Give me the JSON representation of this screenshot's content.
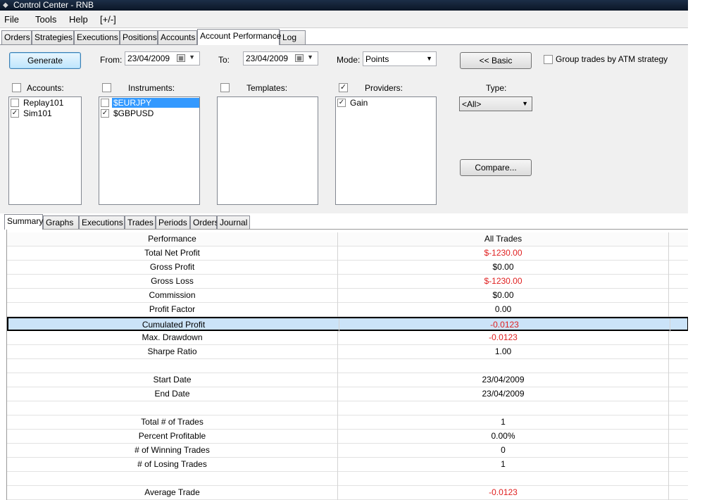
{
  "window": {
    "title": "Control Center - RNB",
    "icon": "app-icon"
  },
  "menu": [
    "File",
    "Tools",
    "Help",
    "[+/-]"
  ],
  "tabs": [
    "Orders",
    "Strategies",
    "Executions",
    "Positions",
    "Accounts",
    "Account Performance",
    "Log"
  ],
  "active_tab": "Account Performance",
  "controls": {
    "generate_label": "Generate",
    "from_label": "From:",
    "from_value": "23/04/2009",
    "to_label": "To:",
    "to_value": "23/04/2009",
    "mode_label": "Mode:",
    "mode_value": "Points",
    "basic_label": "<< Basic",
    "group_atm_label": "Group trades by ATM strategy",
    "type_label": "Type:",
    "type_value": "<All>",
    "compare_label": "Compare..."
  },
  "lists": {
    "accounts": {
      "label": "Accounts:",
      "header_checked": false,
      "items": [
        {
          "name": "Replay101",
          "checked": false
        },
        {
          "name": "Sim101",
          "checked": true
        }
      ]
    },
    "instruments": {
      "label": "Instruments:",
      "header_checked": false,
      "items": [
        {
          "name": "$EURJPY",
          "checked": false,
          "selected": true
        },
        {
          "name": "$GBPUSD",
          "checked": true
        }
      ]
    },
    "templates": {
      "label": "Templates:",
      "header_checked": false,
      "items": []
    },
    "providers": {
      "label": "Providers:",
      "header_checked": true,
      "items": [
        {
          "name": "Gain",
          "checked": true
        }
      ]
    }
  },
  "subtabs": [
    "Summary",
    "Graphs",
    "Executions",
    "Trades",
    "Periods",
    "Orders",
    "Journal"
  ],
  "active_subtab": "Summary",
  "grid": {
    "headers": [
      "Performance",
      "All Trades"
    ],
    "rows": [
      {
        "label": "Total Net Profit",
        "value": "$-1230.00",
        "negative": true
      },
      {
        "label": "Gross Profit",
        "value": "$0.00",
        "negative": false
      },
      {
        "label": "Gross Loss",
        "value": "$-1230.00",
        "negative": true
      },
      {
        "label": "Commission",
        "value": "$0.00",
        "negative": false
      },
      {
        "label": "Profit Factor",
        "value": "0.00",
        "negative": false
      },
      {
        "label": "Cumulated Profit",
        "value": "-0.0123",
        "negative": true,
        "selected": true
      },
      {
        "label": "Max. Drawdown",
        "value": "-0.0123",
        "negative": true
      },
      {
        "label": "Sharpe Ratio",
        "value": "1.00",
        "negative": false
      },
      {
        "label": "",
        "value": "",
        "negative": false
      },
      {
        "label": "Start Date",
        "value": "23/04/2009",
        "negative": false
      },
      {
        "label": "End Date",
        "value": "23/04/2009",
        "negative": false
      },
      {
        "label": "",
        "value": "",
        "negative": false
      },
      {
        "label": "Total # of Trades",
        "value": "1",
        "negative": false
      },
      {
        "label": "Percent Profitable",
        "value": "0.00%",
        "negative": false
      },
      {
        "label": "# of Winning Trades",
        "value": "0",
        "negative": false
      },
      {
        "label": "# of Losing Trades",
        "value": "1",
        "negative": false
      },
      {
        "label": "",
        "value": "",
        "negative": false
      },
      {
        "label": "Average Trade",
        "value": "-0.0123",
        "negative": true
      }
    ]
  },
  "colors": {
    "negative": "#e02020",
    "selection": "#3399ff",
    "title_bar": "#0b1626"
  }
}
